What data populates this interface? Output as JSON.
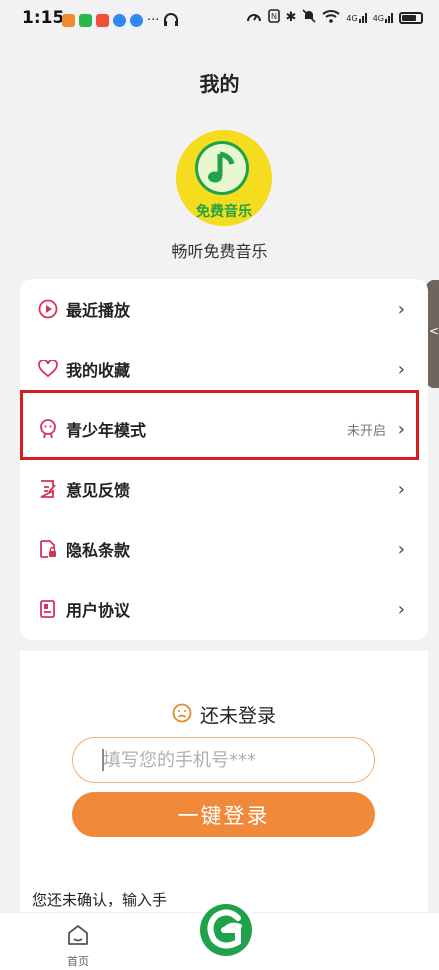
{
  "status_bar": {
    "time": "1:15",
    "dots": "···",
    "app_colors": [
      "#f08a2a",
      "#2bb84a",
      "#f0503a",
      "#2d8cf0",
      "#2d8cf0"
    ],
    "signal_1": "4G",
    "signal_2": "4G"
  },
  "page": {
    "title": "我的"
  },
  "app": {
    "logo_text": "免费音乐",
    "name": "畅听免费音乐"
  },
  "menu": {
    "items": [
      {
        "label": "最近播放",
        "icon": "play-circle-icon",
        "status": ""
      },
      {
        "label": "我的收藏",
        "icon": "heart-icon",
        "status": ""
      },
      {
        "label": "青少年模式",
        "icon": "youth-mode-icon",
        "status": "未开启"
      },
      {
        "label": "意见反馈",
        "icon": "feedback-icon",
        "status": ""
      },
      {
        "label": "隐私条款",
        "icon": "privacy-doc-icon",
        "status": ""
      },
      {
        "label": "用户协议",
        "icon": "agreement-doc-icon",
        "status": ""
      }
    ],
    "chevron": "›"
  },
  "login": {
    "status_text": "还未登录",
    "phone_placeholder": "填写您的手机号***",
    "button_label": "一键登录",
    "agreement_text": "您还未确认，输入手"
  },
  "bottom_nav": {
    "home_label": "首页"
  },
  "colors": {
    "accent": "#f08a3a",
    "menu_icon": "#d6335a",
    "highlight": "#d81b1b",
    "logo_yellow": "#f5dc1e",
    "logo_green": "#1fa24a"
  }
}
